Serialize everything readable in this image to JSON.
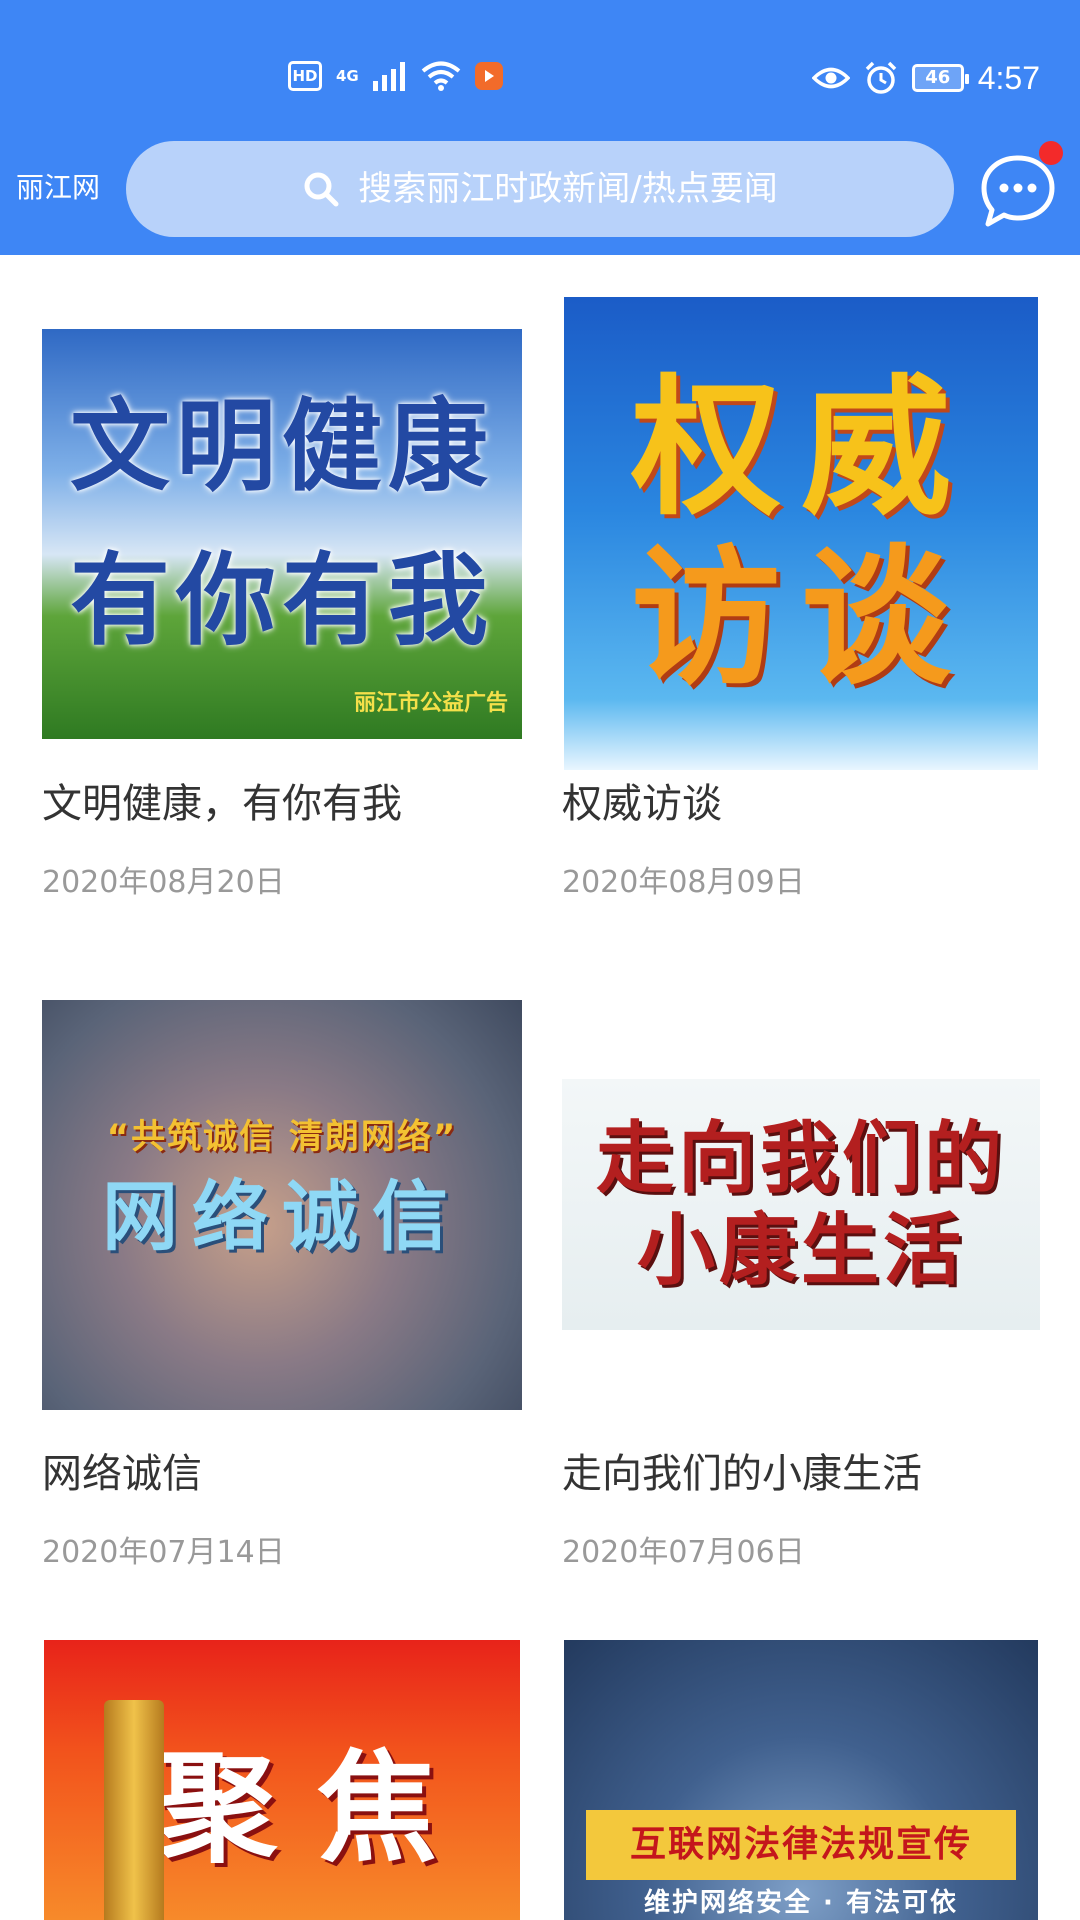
{
  "status_bar": {
    "hd": "HD",
    "network": "4G",
    "battery": "46",
    "time": "4:57"
  },
  "header": {
    "site_name": "丽江网",
    "search_placeholder": "搜索丽江时政新闻/热点要闻"
  },
  "articles": [
    {
      "title": "文明健康，有你有我",
      "date": "2020年08月20日",
      "thumb_lines": [
        "文明健康",
        "有你有我"
      ],
      "thumb_caption": "丽江市公益广告"
    },
    {
      "title": "权威访谈",
      "date": "2020年08月09日",
      "thumb_lines": [
        "权威",
        "访谈"
      ]
    },
    {
      "title": "网络诚信",
      "date": "2020年07月14日",
      "thumb_lines": [
        "“共筑诚信 清朗网络”",
        "网络诚信"
      ]
    },
    {
      "title": "走向我们的小康生活",
      "date": "2020年07月06日",
      "thumb_lines": [
        "走向我们的",
        "小康生活"
      ]
    },
    {
      "title": "",
      "date": "",
      "thumb_lines": [
        "聚焦"
      ]
    },
    {
      "title": "",
      "date": "",
      "thumb_lines": [
        "互联网法律法规宣传",
        "维护网络安全 · 有法可依"
      ]
    }
  ],
  "colors": {
    "header_bg": "#3e86f5",
    "search_bg": "#b8d2fa",
    "badge_red": "#f32a2a"
  }
}
